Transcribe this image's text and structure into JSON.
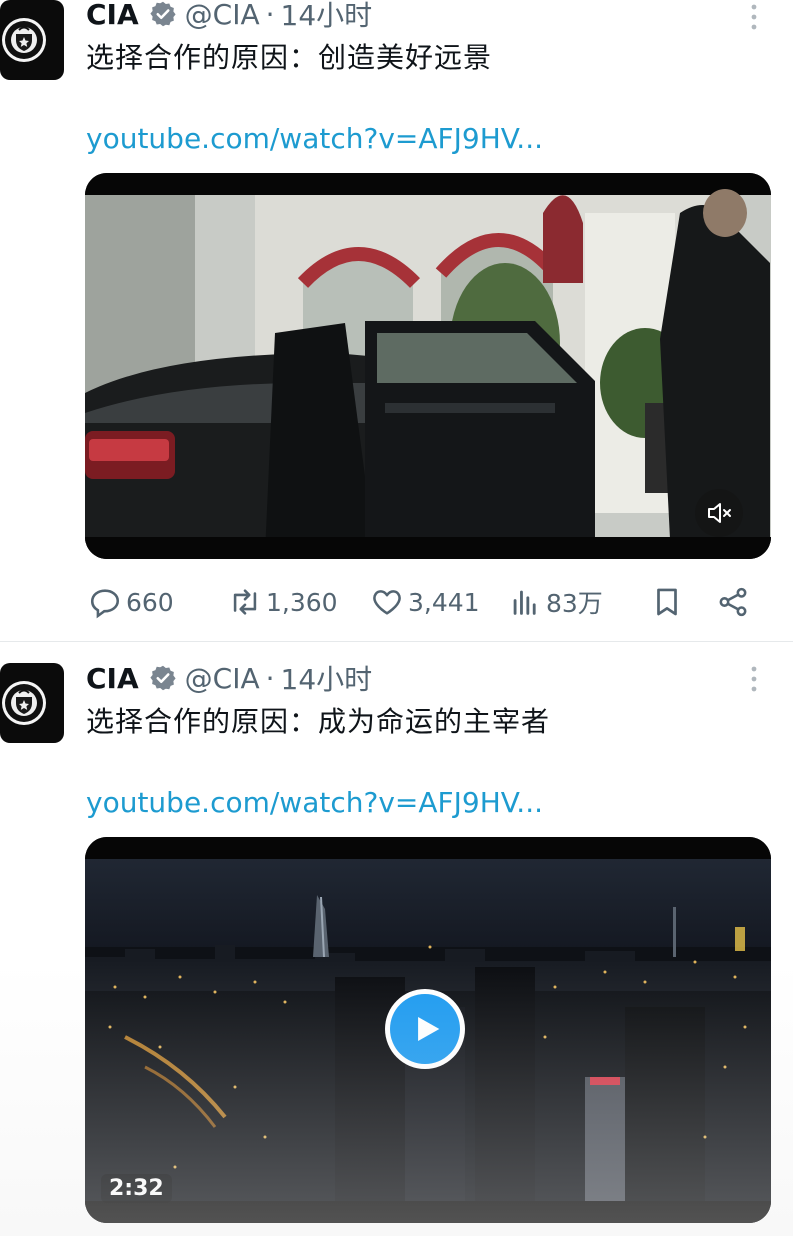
{
  "tweets": [
    {
      "author_name": "CIA",
      "handle": "@CIA",
      "separator": "·",
      "time": "14小时",
      "text": "选择合作的原因：创造美好远景",
      "link": "youtube.com/watch?v=AFJ9HV...",
      "media_type": "video-paused-muted",
      "stats": {
        "replies": "660",
        "retweets": "1,360",
        "likes": "3,441",
        "views": "83万"
      }
    },
    {
      "author_name": "CIA",
      "handle": "@CIA",
      "separator": "·",
      "time": "14小时",
      "text": "选择合作的原因：成为命运的主宰者",
      "link": "youtube.com/watch?v=AFJ9HV...",
      "media_type": "video-with-play-button",
      "duration": "2:32"
    }
  ],
  "icons": {
    "verified": "verified-badge-icon",
    "more": "more-vertical-icon",
    "reply": "reply-icon",
    "retweet": "retweet-icon",
    "like": "heart-icon",
    "views": "views-chart-icon",
    "bookmark": "bookmark-icon",
    "share": "share-icon",
    "mute": "mute-icon",
    "play": "play-icon"
  },
  "colors": {
    "link": "#1d9bd0",
    "secondary_text": "#536471",
    "play_button": "#1d9bf0"
  }
}
